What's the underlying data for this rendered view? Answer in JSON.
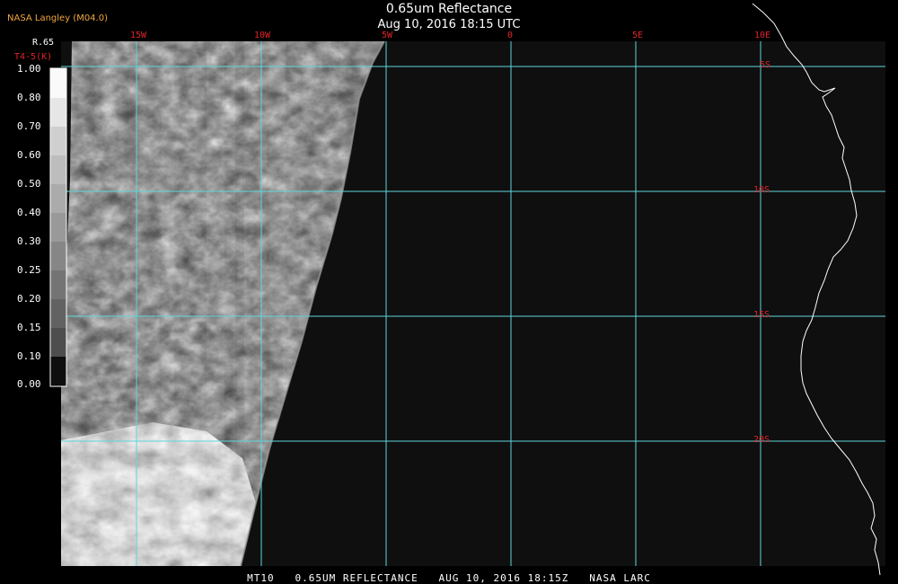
{
  "header": {
    "title": "0.65um Reflectance",
    "datetime": "Aug 10, 2016 18:15 UTC",
    "credit": "NASA Langley (M04.0)"
  },
  "footer": {
    "caption": "MT10   0.65UM REFLECTANCE   AUG 10, 2016 18:15Z   NASA LARC"
  },
  "colorbar": {
    "name": "R.65",
    "sub_label": "T4-5(K)",
    "ticks": [
      "1.00",
      "0.80",
      "0.70",
      "0.60",
      "0.50",
      "0.40",
      "0.30",
      "0.25",
      "0.20",
      "0.15",
      "0.10",
      "0.00"
    ]
  },
  "map": {
    "longitude_labels": [
      "15W",
      "10W",
      "5W",
      "0",
      "5E",
      "10E"
    ],
    "latitude_labels": [
      "5S",
      "10S",
      "15S",
      "20S"
    ],
    "colors": {
      "grid": "#5fd6dc",
      "labels": "#e0242a",
      "coastline": "#ffffff",
      "background": "#0f0f0f",
      "credit": "#f2a640"
    }
  }
}
